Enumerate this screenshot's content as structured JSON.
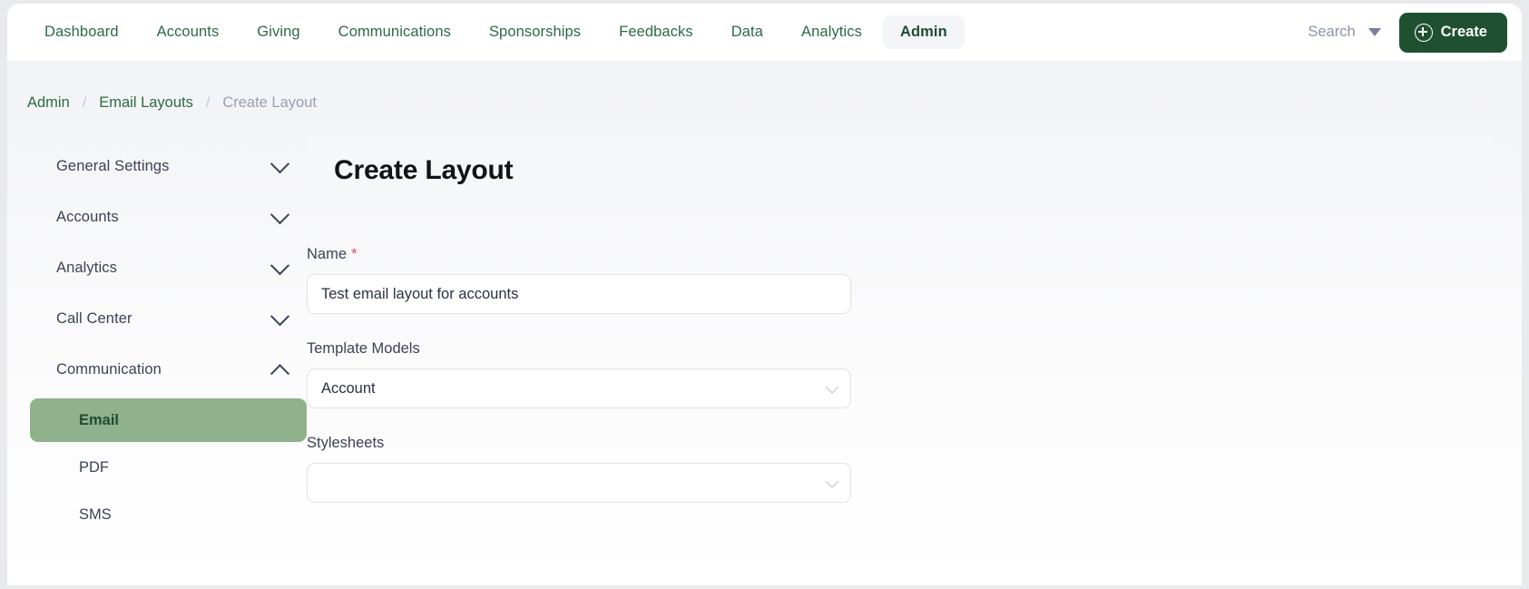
{
  "topnav": {
    "items": [
      {
        "label": "Dashboard",
        "active": false
      },
      {
        "label": "Accounts",
        "active": false
      },
      {
        "label": "Giving",
        "active": false
      },
      {
        "label": "Communications",
        "active": false
      },
      {
        "label": "Sponsorships",
        "active": false
      },
      {
        "label": "Feedbacks",
        "active": false
      },
      {
        "label": "Data",
        "active": false
      },
      {
        "label": "Analytics",
        "active": false
      },
      {
        "label": "Admin",
        "active": true
      }
    ],
    "search_label": "Search",
    "create_label": "Create"
  },
  "breadcrumb": {
    "items": [
      {
        "label": "Admin",
        "current": false
      },
      {
        "label": "Email Layouts",
        "current": false
      },
      {
        "label": "Create Layout",
        "current": true
      }
    ],
    "separator": "/"
  },
  "sidebar": {
    "groups": [
      {
        "label": "General Settings",
        "expanded": false
      },
      {
        "label": "Accounts",
        "expanded": false
      },
      {
        "label": "Analytics",
        "expanded": false
      },
      {
        "label": "Call Center",
        "expanded": false
      },
      {
        "label": "Communication",
        "expanded": true
      }
    ],
    "subitems": [
      {
        "label": "Email",
        "active": true
      },
      {
        "label": "PDF",
        "active": false
      },
      {
        "label": "SMS",
        "active": false
      }
    ]
  },
  "form": {
    "title": "Create Layout",
    "name": {
      "label": "Name",
      "required_marker": "*",
      "value": "Test email layout for accounts",
      "placeholder": ""
    },
    "template_models": {
      "label": "Template Models",
      "value": "Account"
    },
    "stylesheets": {
      "label": "Stylesheets",
      "value": ""
    }
  },
  "colors": {
    "brand_green": "#1f5130",
    "nav_green": "#2d6a43",
    "sage_highlight": "#8fb18c",
    "required_red": "#e2506b",
    "muted_text": "#8d93a8"
  }
}
